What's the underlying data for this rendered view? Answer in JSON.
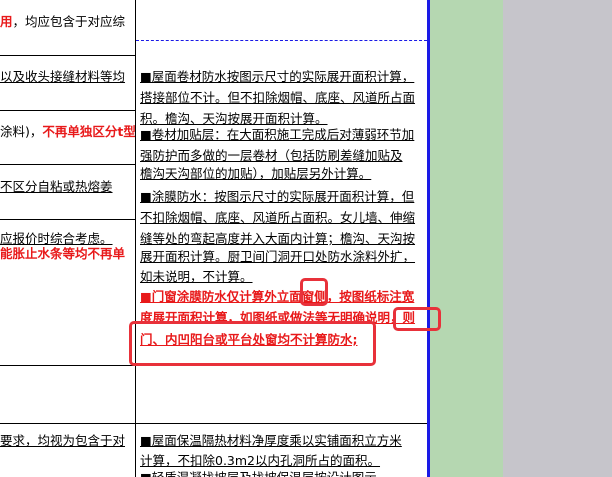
{
  "left_column": {
    "line_1_red": "用",
    "line_1_rest": "，均应包含于对应综",
    "line_2": "以及收头接缝材料等均",
    "line_3_black": "涂料)，",
    "line_3_red": "不再单独区分t型",
    "line_4": "不区分自粘或热熔姜",
    "line_5": "应报价时综合考虑。",
    "line_6": "能胀止水条等均不再单",
    "line_7": "要求，均视为包含于对"
  },
  "middle_column": {
    "roof_1": "■屋面卷材防水按图示尺寸的实际展开面积计算，",
    "roof_2": "搭接部位不计。但不扣除烟帽、底座、风道所占面",
    "roof_3": "积。檐沟、天沟按展开面积计算。",
    "add_1": "■卷材加贴层：在大面积施工完成后对薄弱环节加",
    "add_2": "强防护而多做的一层卷材（包括防刷差缝加贴及",
    "add_3": "檐沟天沟部位的加贴），加贴层另外计算。",
    "coat_1": "■涂膜防水：按图示尺寸的实际展开面积计算，但",
    "coat_2": "不扣除烟帽、底座、风道所占面积。女儿墙、伸缩",
    "coat_3": "缝等处的弯起高度并入大面内计算；檐沟、天沟按",
    "coat_4": "展开面积计算。厨卫间门洞开口处防水涂料外扩，",
    "coat_5": "如未说明，不计算。",
    "door_1": "■门窗涂膜防水仅计算外立面窗侧，按图纸标注宽",
    "door_2": "度展开面积计算，如图纸或做法等无明确说明，则",
    "door_3": "门、内凹阳台或平台处窗均不计算防水;",
    "insul_1": "■屋面保温隔热材料净厚度乘以实铺面积立方米",
    "insul_2": "计算，不扣除0.3m2以内孔洞所占的面积。",
    "insul_3": "■轻质混凝找坡层及找坡保温层按设计图示"
  },
  "colors": {
    "highlight_red": "#e8191a",
    "annotation_box": "#e8313a",
    "blue_border": "#1a1ae6",
    "side_green": "#b5d7b1",
    "side_gray": "#c6c5cb"
  }
}
